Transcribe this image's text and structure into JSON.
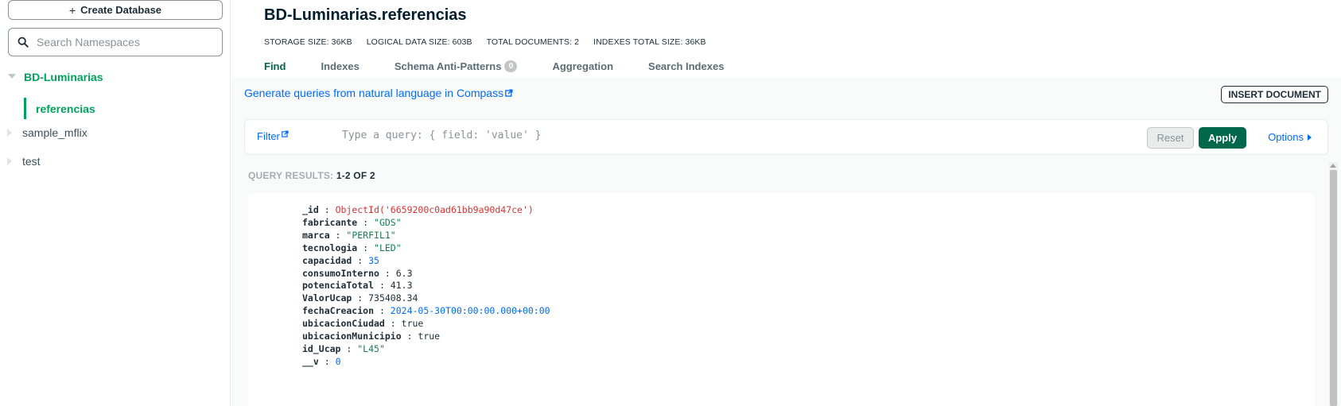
{
  "sidebar": {
    "create_database_label": "Create Database",
    "search_placeholder": "Search Namespaces",
    "databases": [
      {
        "name": "BD-Luminarias",
        "expanded": true,
        "collections": [
          "referencias"
        ]
      },
      {
        "name": "sample_mflix",
        "expanded": false
      },
      {
        "name": "test",
        "expanded": false
      }
    ],
    "active_collection": "referencias"
  },
  "header": {
    "title": "BD-Luminarias.referencias",
    "stats": {
      "storage_size": "STORAGE SIZE: 36KB",
      "logical_data_size": "LOGICAL DATA SIZE: 603B",
      "total_documents": "TOTAL DOCUMENTS: 2",
      "indexes_total_size": "INDEXES TOTAL SIZE: 36KB"
    },
    "tabs": [
      {
        "label": "Find",
        "active": true
      },
      {
        "label": "Indexes"
      },
      {
        "label": "Schema Anti-Patterns",
        "badge": "0"
      },
      {
        "label": "Aggregation"
      },
      {
        "label": "Search Indexes"
      }
    ]
  },
  "toolbar": {
    "nl_link": "Generate queries from natural language in Compass",
    "insert_document_label": "INSERT DOCUMENT"
  },
  "filter": {
    "label": "Filter",
    "placeholder": "Type a query: { field: 'value' }",
    "reset_label": "Reset",
    "apply_label": "Apply",
    "options_label": "Options"
  },
  "results": {
    "label": "QUERY RESULTS:",
    "count": "1-2 OF 2"
  },
  "document": {
    "fields": [
      {
        "key": "_id",
        "value": "ObjectId('6659200c0ad61bb9a90d47ce')",
        "type": "oid"
      },
      {
        "key": "fabricante",
        "value": "\"GDS\"",
        "type": "str"
      },
      {
        "key": "marca",
        "value": "\"PERFIL1\"",
        "type": "str"
      },
      {
        "key": "tecnologia",
        "value": "\"LED\"",
        "type": "str"
      },
      {
        "key": "capacidad",
        "value": "35",
        "type": "num"
      },
      {
        "key": "consumoInterno",
        "value": "6.3",
        "type": "plain"
      },
      {
        "key": "potenciaTotal",
        "value": "41.3",
        "type": "plain"
      },
      {
        "key": "ValorUcap",
        "value": "735408.34",
        "type": "plain"
      },
      {
        "key": "fechaCreacion",
        "value": "2024-05-30T00:00:00.000+00:00",
        "type": "date"
      },
      {
        "key": "ubicacionCiudad",
        "value": "true",
        "type": "plain"
      },
      {
        "key": "ubicacionMunicipio",
        "value": "true",
        "type": "plain"
      },
      {
        "key": "id_Ucap",
        "value": "\"L45\"",
        "type": "str"
      },
      {
        "key": "__v",
        "value": "0",
        "type": "num"
      }
    ]
  },
  "colors": {
    "accent_green": "#00a35c",
    "apply_green": "#00684a",
    "link_blue": "#016bf8",
    "oid_red": "#db3030",
    "string_green": "#12824d"
  }
}
